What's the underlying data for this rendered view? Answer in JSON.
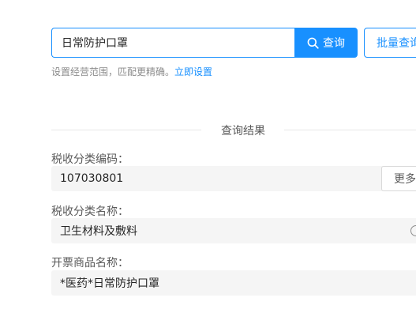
{
  "search": {
    "value": "日常防护口罩",
    "button_label": "查询",
    "batch_label": "批量查询"
  },
  "hint": {
    "text": "设置经营范围，匹配更精确。",
    "link": "立即设置"
  },
  "results": {
    "divider_label": "查询结果",
    "code_label": "税收分类编码：",
    "code_value": "107030801",
    "more_label": "更多",
    "name_label": "税收分类名称：",
    "name_value": "卫生材料及敷料",
    "product_label": "开票商品名称：",
    "product_value": "*医药*日常防护口罩"
  },
  "colors": {
    "accent": "#1890ff",
    "field_bg": "#f5f5f5"
  },
  "icons": {
    "search": "search-icon",
    "info": "info-icon"
  }
}
